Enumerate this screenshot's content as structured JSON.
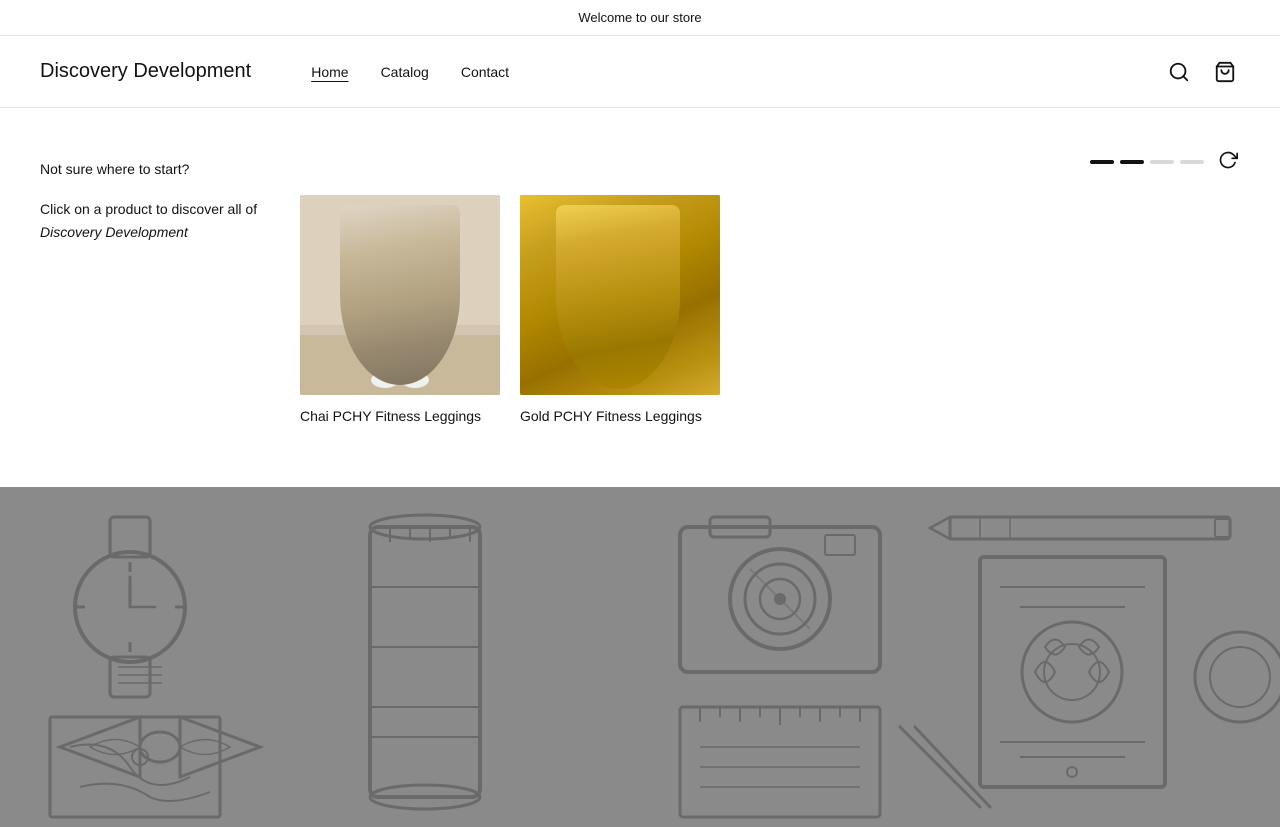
{
  "announcement": {
    "text": "Welcome to our store"
  },
  "header": {
    "logo": "Discovery Development",
    "nav": [
      {
        "label": "Home",
        "active": true
      },
      {
        "label": "Catalog",
        "active": false
      },
      {
        "label": "Contact",
        "active": false
      }
    ],
    "icons": {
      "search": "search-icon",
      "cart": "cart-icon"
    }
  },
  "main": {
    "sidebar": {
      "line1": "Not sure where to start?",
      "line2": "Click on a product to discover all of ",
      "brand": "Discovery Development",
      "brand_italic": true
    },
    "pagination": {
      "dots": [
        "dark",
        "dark",
        "light",
        "light"
      ]
    },
    "products": [
      {
        "id": "chai",
        "name": "Chai PCHY Fitness Leggings",
        "image_type": "chai"
      },
      {
        "id": "gold",
        "name": "Gold PCHY Fitness Leggings",
        "image_type": "gold"
      }
    ]
  },
  "footer_banner": {
    "background_color": "#8a8a8a"
  }
}
